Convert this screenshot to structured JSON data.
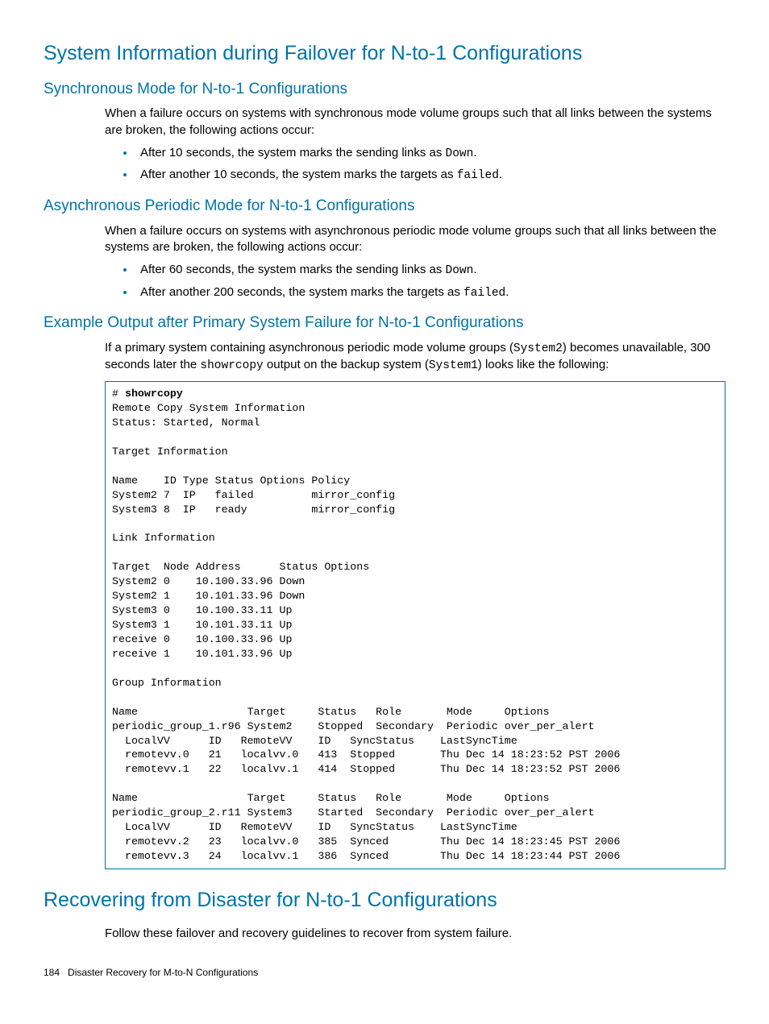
{
  "section1": {
    "title": "System Information during Failover for N-to-1 Configurations",
    "sync": {
      "title": "Synchronous Mode for N-to-1 Configurations",
      "para": "When a failure occurs on systems with synchronous mode volume groups such that all links between the systems are broken, the following actions occur:",
      "bullet1_a": "After 10 seconds, the system marks the sending links as ",
      "bullet1_code": "Down",
      "bullet1_b": ".",
      "bullet2_a": "After another 10 seconds, the system marks the targets as ",
      "bullet2_code": "failed",
      "bullet2_b": "."
    },
    "async": {
      "title": "Asynchronous Periodic Mode for N-to-1 Configurations",
      "para": "When a failure occurs on systems with asynchronous periodic mode volume groups such that all links between the systems are broken, the following actions occur:",
      "bullet1_a": "After 60 seconds, the system marks the sending links as ",
      "bullet1_code": "Down",
      "bullet1_b": ".",
      "bullet2_a": "After another 200 seconds, the system marks the targets as ",
      "bullet2_code": "failed",
      "bullet2_b": "."
    },
    "example": {
      "title": "Example Output after Primary System Failure for N-to-1 Configurations",
      "para_a": "If a primary system containing asynchronous periodic mode volume groups (",
      "para_code1": "System2",
      "para_b": ") becomes unavailable, 300 seconds later the ",
      "para_code2": "showrcopy",
      "para_c": " output on the backup system (",
      "para_code3": "System1",
      "para_d": ") looks like the following:",
      "prompt": "# ",
      "cmd": "showrcopy",
      "output": "\nRemote Copy System Information\nStatus: Started, Normal\n\nTarget Information\n\nName    ID Type Status Options Policy\nSystem2 7  IP   failed         mirror_config\nSystem3 8  IP   ready          mirror_config\n\nLink Information\n\nTarget  Node Address      Status Options\nSystem2 0    10.100.33.96 Down\nSystem2 1    10.101.33.96 Down\nSystem3 0    10.100.33.11 Up\nSystem3 1    10.101.33.11 Up\nreceive 0    10.100.33.96 Up\nreceive 1    10.101.33.96 Up\n\nGroup Information\n\nName                 Target     Status   Role       Mode     Options\nperiodic_group_1.r96 System2    Stopped  Secondary  Periodic over_per_alert\n  LocalVV      ID   RemoteVV    ID   SyncStatus    LastSyncTime\n  remotevv.0   21   localvv.0   413  Stopped       Thu Dec 14 18:23:52 PST 2006\n  remotevv.1   22   localvv.1   414  Stopped       Thu Dec 14 18:23:52 PST 2006\n\nName                 Target     Status   Role       Mode     Options\nperiodic_group_2.r11 System3    Started  Secondary  Periodic over_per_alert\n  LocalVV      ID   RemoteVV    ID   SyncStatus    LastSyncTime\n  remotevv.2   23   localvv.0   385  Synced        Thu Dec 14 18:23:45 PST 2006\n  remotevv.3   24   localvv.1   386  Synced        Thu Dec 14 18:23:44 PST 2006"
    }
  },
  "section2": {
    "title": "Recovering from Disaster for N-to-1 Configurations",
    "para": "Follow these failover and recovery guidelines to recover from system failure."
  },
  "footer": {
    "page": "184",
    "chapter": "Disaster Recovery for M-to-N Configurations"
  }
}
